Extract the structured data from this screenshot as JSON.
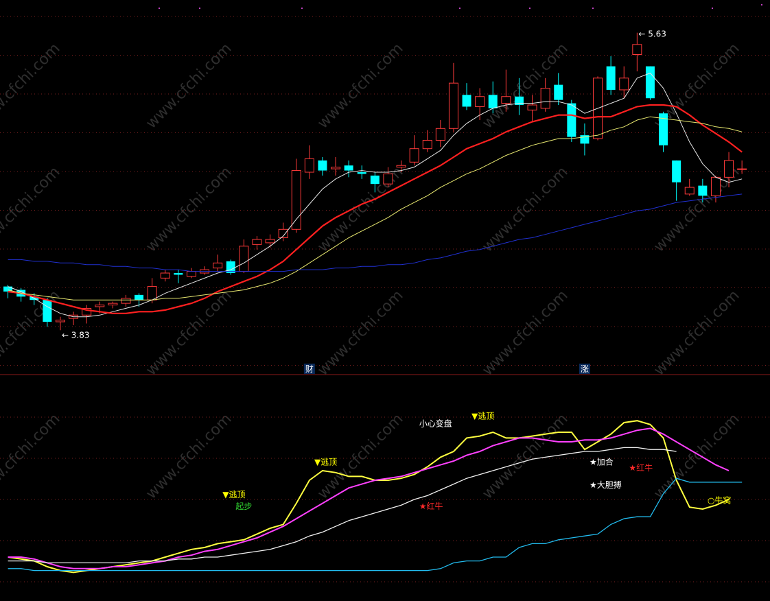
{
  "colors": {
    "background": "#000000",
    "up_candle": "#ff3a3a",
    "down_candle": "#00ffff",
    "ma_white": "#e6e6e6",
    "ma_red": "#ff2020",
    "ma_yellow": "#e8e870",
    "ma_blue": "#2030d0",
    "grid": "#7a1f1f",
    "separator": "#8b1a1a",
    "ind_yellow": "#ffff40",
    "ind_magenta": "#ff40ff",
    "ind_white": "#f0f0f0",
    "ind_cyan": "#22bbee",
    "signal_yellow": "#ffff00",
    "signal_red": "#ff2a2a",
    "signal_white": "#ffffff",
    "signal_green": "#30d030"
  },
  "watermark": "www.cfchi.com",
  "chart_data": [
    {
      "type": "candlestick",
      "y_range": [
        3.6,
        5.8
      ],
      "high_label": "5.63",
      "low_label": "3.83",
      "event_markers": [
        {
          "label": "财",
          "bar": 23
        },
        {
          "label": "涨",
          "bar": 44
        }
      ],
      "candles": [
        {
          "o": 4.12,
          "c": 4.09,
          "h": 4.13,
          "l": 4.05
        },
        {
          "o": 4.1,
          "c": 4.06,
          "h": 4.11,
          "l": 4.03
        },
        {
          "o": 4.06,
          "c": 4.04,
          "h": 4.08,
          "l": 4.01
        },
        {
          "o": 4.04,
          "c": 3.91,
          "h": 4.05,
          "l": 3.88
        },
        {
          "o": 3.91,
          "c": 3.92,
          "h": 3.94,
          "l": 3.86
        },
        {
          "o": 3.93,
          "c": 3.95,
          "h": 3.97,
          "l": 3.89
        },
        {
          "o": 3.95,
          "c": 3.99,
          "h": 4.01,
          "l": 3.9
        },
        {
          "o": 4.0,
          "c": 4.01,
          "h": 4.03,
          "l": 3.96
        },
        {
          "o": 4.01,
          "c": 4.02,
          "h": 4.03,
          "l": 3.99
        },
        {
          "o": 4.02,
          "c": 4.05,
          "h": 4.07,
          "l": 4.0
        },
        {
          "o": 4.07,
          "c": 4.04,
          "h": 4.08,
          "l": 4.0
        },
        {
          "o": 4.04,
          "c": 4.12,
          "h": 4.17,
          "l": 4.02
        },
        {
          "o": 4.17,
          "c": 4.2,
          "h": 4.22,
          "l": 4.15
        },
        {
          "o": 4.2,
          "c": 4.19,
          "h": 4.22,
          "l": 4.14
        },
        {
          "o": 4.18,
          "c": 4.21,
          "h": 4.23,
          "l": 4.17
        },
        {
          "o": 4.2,
          "c": 4.22,
          "h": 4.24,
          "l": 4.19
        },
        {
          "o": 4.23,
          "c": 4.26,
          "h": 4.31,
          "l": 4.21
        },
        {
          "o": 4.27,
          "c": 4.2,
          "h": 4.28,
          "l": 4.19
        },
        {
          "o": 4.21,
          "c": 4.36,
          "h": 4.4,
          "l": 4.2
        },
        {
          "o": 4.37,
          "c": 4.4,
          "h": 4.42,
          "l": 4.34
        },
        {
          "o": 4.38,
          "c": 4.4,
          "h": 4.43,
          "l": 4.35
        },
        {
          "o": 4.41,
          "c": 4.46,
          "h": 4.5,
          "l": 4.39
        },
        {
          "o": 4.46,
          "c": 4.81,
          "h": 4.88,
          "l": 4.44
        },
        {
          "o": 4.8,
          "c": 4.88,
          "h": 4.96,
          "l": 4.76
        },
        {
          "o": 4.87,
          "c": 4.81,
          "h": 4.89,
          "l": 4.78
        },
        {
          "o": 4.82,
          "c": 4.83,
          "h": 4.89,
          "l": 4.78
        },
        {
          "o": 4.84,
          "c": 4.81,
          "h": 4.87,
          "l": 4.77
        },
        {
          "o": 4.8,
          "c": 4.79,
          "h": 4.84,
          "l": 4.76
        },
        {
          "o": 4.78,
          "c": 4.73,
          "h": 4.8,
          "l": 4.68
        },
        {
          "o": 4.73,
          "c": 4.79,
          "h": 4.83,
          "l": 4.71
        },
        {
          "o": 4.83,
          "c": 4.84,
          "h": 4.87,
          "l": 4.8
        },
        {
          "o": 4.86,
          "c": 4.94,
          "h": 5.02,
          "l": 4.84
        },
        {
          "o": 4.94,
          "c": 4.99,
          "h": 5.05,
          "l": 4.92
        },
        {
          "o": 4.99,
          "c": 5.06,
          "h": 5.11,
          "l": 4.95
        },
        {
          "o": 5.06,
          "c": 5.33,
          "h": 5.45,
          "l": 5.04
        },
        {
          "o": 5.26,
          "c": 5.19,
          "h": 5.33,
          "l": 5.17
        },
        {
          "o": 5.19,
          "c": 5.25,
          "h": 5.3,
          "l": 5.11
        },
        {
          "o": 5.26,
          "c": 5.18,
          "h": 5.34,
          "l": 5.15
        },
        {
          "o": 5.21,
          "c": 5.25,
          "h": 5.41,
          "l": 5.16
        },
        {
          "o": 5.25,
          "c": 5.2,
          "h": 5.36,
          "l": 5.14
        },
        {
          "o": 5.17,
          "c": 5.2,
          "h": 5.26,
          "l": 5.1
        },
        {
          "o": 5.18,
          "c": 5.3,
          "h": 5.36,
          "l": 5.16
        },
        {
          "o": 5.32,
          "c": 5.23,
          "h": 5.39,
          "l": 5.2
        },
        {
          "o": 5.21,
          "c": 5.01,
          "h": 5.23,
          "l": 4.98
        },
        {
          "o": 5.02,
          "c": 4.97,
          "h": 5.09,
          "l": 4.9
        },
        {
          "o": 5.0,
          "c": 5.36,
          "h": 5.37,
          "l": 4.99
        },
        {
          "o": 5.43,
          "c": 5.29,
          "h": 5.49,
          "l": 5.26
        },
        {
          "o": 5.29,
          "c": 5.36,
          "h": 5.43,
          "l": 5.24
        },
        {
          "o": 5.5,
          "c": 5.56,
          "h": 5.63,
          "l": 5.4
        },
        {
          "o": 5.43,
          "c": 5.24,
          "h": 5.43,
          "l": 5.23
        },
        {
          "o": 5.15,
          "c": 4.96,
          "h": 5.16,
          "l": 4.92
        },
        {
          "o": 4.87,
          "c": 4.74,
          "h": 4.87,
          "l": 4.63
        },
        {
          "o": 4.67,
          "c": 4.71,
          "h": 4.76,
          "l": 4.66
        },
        {
          "o": 4.72,
          "c": 4.66,
          "h": 4.76,
          "l": 4.62
        },
        {
          "o": 4.66,
          "c": 4.77,
          "h": 4.78,
          "l": 4.62
        },
        {
          "o": 4.77,
          "c": 4.87,
          "h": 4.92,
          "l": 4.71
        },
        {
          "o": 4.82,
          "c": 4.82,
          "h": 4.87,
          "l": 4.79
        }
      ],
      "series": [
        {
          "color_key": "ma_white",
          "values": [
            4.12,
            4.09,
            4.05,
            4.0,
            3.96,
            3.94,
            3.94,
            3.95,
            3.97,
            3.99,
            4.01,
            4.04,
            4.08,
            4.11,
            4.14,
            4.17,
            4.2,
            4.22,
            4.26,
            4.31,
            4.36,
            4.42,
            4.52,
            4.61,
            4.7,
            4.76,
            4.8,
            4.81,
            4.8,
            4.8,
            4.81,
            4.83,
            4.88,
            4.93,
            5.02,
            5.09,
            5.14,
            5.18,
            5.2,
            5.21,
            5.21,
            5.22,
            5.22,
            5.2,
            5.15,
            5.18,
            5.21,
            5.24,
            5.36,
            5.39,
            5.3,
            5.15,
            4.98,
            4.85,
            4.77,
            4.74,
            4.76
          ]
        },
        {
          "color_key": "ma_red",
          "values": [
            4.09,
            4.08,
            4.06,
            4.04,
            4.02,
            4.0,
            3.98,
            3.97,
            3.96,
            3.96,
            3.97,
            3.97,
            3.98,
            4.0,
            4.02,
            4.05,
            4.09,
            4.12,
            4.15,
            4.18,
            4.22,
            4.27,
            4.34,
            4.41,
            4.48,
            4.53,
            4.57,
            4.61,
            4.64,
            4.68,
            4.72,
            4.76,
            4.8,
            4.84,
            4.89,
            4.94,
            4.97,
            5.0,
            5.04,
            5.07,
            5.1,
            5.12,
            5.14,
            5.14,
            5.12,
            5.13,
            5.13,
            5.16,
            5.19,
            5.2,
            5.2,
            5.19,
            5.14,
            5.08,
            5.03,
            4.98,
            4.92
          ]
        },
        {
          "color_key": "ma_yellow",
          "values": [
            4.1,
            4.08,
            4.07,
            4.06,
            4.05,
            4.04,
            4.04,
            4.04,
            4.04,
            4.04,
            4.04,
            4.04,
            4.05,
            4.05,
            4.06,
            4.07,
            4.08,
            4.09,
            4.1,
            4.12,
            4.14,
            4.17,
            4.21,
            4.26,
            4.31,
            4.36,
            4.41,
            4.45,
            4.49,
            4.53,
            4.58,
            4.62,
            4.66,
            4.71,
            4.75,
            4.79,
            4.82,
            4.86,
            4.9,
            4.93,
            4.96,
            4.98,
            5.0,
            5.0,
            5.01,
            5.02,
            5.05,
            5.07,
            5.11,
            5.13,
            5.12,
            5.11,
            5.1,
            5.09,
            5.07,
            5.06,
            5.04
          ]
        },
        {
          "color_key": "ma_blue",
          "values": [
            4.28,
            4.28,
            4.27,
            4.27,
            4.26,
            4.26,
            4.25,
            4.25,
            4.24,
            4.24,
            4.23,
            4.23,
            4.22,
            4.22,
            4.21,
            4.21,
            4.21,
            4.21,
            4.21,
            4.21,
            4.21,
            4.21,
            4.22,
            4.22,
            4.22,
            4.23,
            4.23,
            4.24,
            4.24,
            4.25,
            4.25,
            4.26,
            4.28,
            4.29,
            4.31,
            4.33,
            4.34,
            4.36,
            4.38,
            4.4,
            4.41,
            4.43,
            4.45,
            4.47,
            4.49,
            4.51,
            4.53,
            4.55,
            4.57,
            4.58,
            4.6,
            4.62,
            4.63,
            4.64,
            4.65,
            4.66,
            4.67
          ]
        }
      ]
    },
    {
      "type": "line",
      "y_range": [
        0,
        100
      ],
      "series": [
        {
          "color_key": "ind_yellow",
          "values": [
            10,
            9,
            8,
            5,
            3,
            2,
            3,
            4,
            5,
            6,
            7,
            8,
            10,
            12,
            14,
            15,
            17,
            18,
            19,
            22,
            25,
            27,
            38,
            50,
            55,
            54,
            52,
            52,
            50,
            50,
            51,
            53,
            57,
            62,
            65,
            72,
            73,
            75,
            72,
            72,
            73,
            74,
            75,
            75,
            66,
            70,
            74,
            80,
            81,
            79,
            72,
            50,
            36,
            35,
            37,
            40
          ]
        },
        {
          "color_key": "ind_magenta",
          "values": [
            10,
            10,
            9,
            7,
            5,
            4,
            4,
            4,
            5,
            5,
            6,
            7,
            8,
            10,
            11,
            13,
            14,
            16,
            18,
            20,
            23,
            26,
            30,
            34,
            38,
            42,
            46,
            48,
            50,
            51,
            52,
            54,
            56,
            58,
            60,
            63,
            65,
            68,
            70,
            72,
            72,
            71,
            70,
            70,
            71,
            71,
            72,
            74,
            76,
            77,
            74,
            70,
            66,
            62,
            58,
            55
          ]
        },
        {
          "color_key": "ind_white",
          "values": [
            8,
            8,
            8,
            7,
            7,
            7,
            7,
            7,
            7,
            7,
            8,
            8,
            8,
            9,
            9,
            10,
            10,
            11,
            12,
            13,
            14,
            16,
            18,
            21,
            23,
            26,
            29,
            31,
            33,
            35,
            37,
            40,
            42,
            45,
            48,
            51,
            53,
            55,
            57,
            59,
            61,
            62,
            63,
            64,
            65,
            65,
            66,
            67,
            67,
            66,
            66,
            65
          ]
        },
        {
          "color_key": "ind_cyan",
          "values": [
            4,
            4,
            3,
            3,
            3,
            3,
            3,
            3,
            3,
            3,
            3,
            3,
            3,
            3,
            3,
            3,
            3,
            3,
            3,
            3,
            3,
            3,
            3,
            3,
            3,
            3,
            3,
            3,
            3,
            3,
            3,
            3,
            3,
            4,
            7,
            8,
            8,
            10,
            10,
            15,
            17,
            17,
            19,
            20,
            21,
            22,
            27,
            30,
            31,
            31,
            43,
            51,
            49,
            49,
            49,
            49,
            49
          ]
        }
      ],
      "annotations": [
        {
          "label": "▼逃顶",
          "bar": 17,
          "y": 41,
          "color_key": "signal_yellow",
          "arrow": "down"
        },
        {
          "label": "▼逃顶",
          "bar": 24,
          "y": 58,
          "color_key": "signal_yellow",
          "arrow": "down"
        },
        {
          "label": "▼逃顶",
          "bar": 36,
          "y": 82,
          "color_key": "signal_yellow",
          "arrow": "down"
        },
        {
          "label": "小心变盘",
          "bar": 32,
          "y": 78,
          "color_key": "signal_white"
        },
        {
          "label": "★红牛",
          "bar": 32,
          "y": 35,
          "color_key": "signal_red"
        },
        {
          "label": "★加合",
          "bar": 45,
          "y": 58,
          "color_key": "signal_white"
        },
        {
          "label": "★红牛",
          "bar": 48,
          "y": 55,
          "color_key": "signal_red"
        },
        {
          "label": "★大胆搏",
          "bar": 45,
          "y": 46,
          "color_key": "signal_white"
        },
        {
          "label": "○牛窝",
          "bar": 54,
          "y": 38,
          "color_key": "signal_yellow"
        },
        {
          "label": "起步",
          "bar": 18,
          "y": 35,
          "color_key": "signal_green"
        }
      ]
    }
  ]
}
